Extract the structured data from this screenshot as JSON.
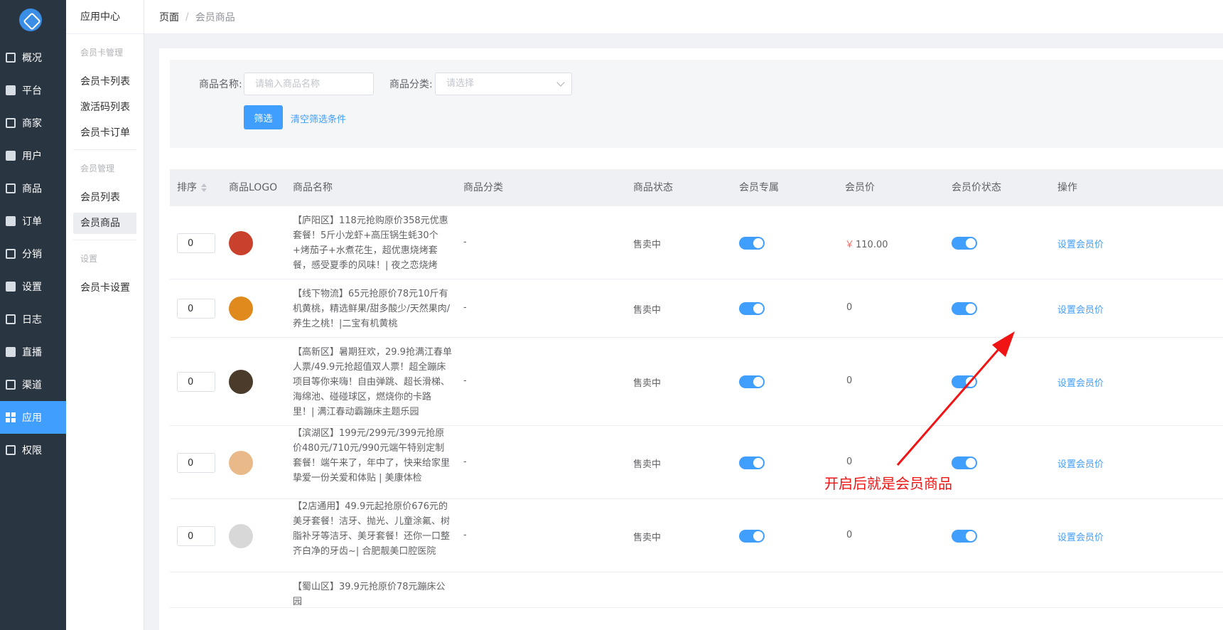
{
  "nav_rail": {
    "items": [
      {
        "label": "概况",
        "icon": "chart-icon"
      },
      {
        "label": "平台",
        "icon": "monitor-icon"
      },
      {
        "label": "商家",
        "icon": "store-icon"
      },
      {
        "label": "用户",
        "icon": "user-icon"
      },
      {
        "label": "商品",
        "icon": "product-icon"
      },
      {
        "label": "订单",
        "icon": "order-icon"
      },
      {
        "label": "分销",
        "icon": "distribution-icon"
      },
      {
        "label": "设置",
        "icon": "gear-icon"
      },
      {
        "label": "日志",
        "icon": "log-icon"
      },
      {
        "label": "直播",
        "icon": "live-icon"
      },
      {
        "label": "渠道",
        "icon": "channel-icon"
      },
      {
        "label": "应用",
        "icon": "apps-icon"
      },
      {
        "label": "权限",
        "icon": "lock-icon"
      }
    ],
    "active_index": 11
  },
  "sub_nav": {
    "title": "应用中心",
    "group_membercard": "会员卡管理",
    "item_card_list": "会员卡列表",
    "item_activation_codes": "激活码列表",
    "item_card_orders": "会员卡订单",
    "group_member": "会员管理",
    "item_member_list": "会员列表",
    "item_member_goods": "会员商品",
    "group_settings": "设置",
    "item_card_settings": "会员卡设置"
  },
  "breadcrumb": {
    "root": "页面",
    "separator": "/",
    "current": "会员商品"
  },
  "filter": {
    "name_label": "商品名称:",
    "name_placeholder": "请输入商品名称",
    "category_label": "商品分类:",
    "category_placeholder": "请选择",
    "submit_label": "筛选",
    "clear_label": "清空筛选条件"
  },
  "table": {
    "headers": {
      "sort": "排序",
      "logo": "商品LOGO",
      "name": "商品名称",
      "category": "商品分类",
      "status": "商品状态",
      "member_only": "会员专属",
      "member_price": "会员价",
      "member_price_status": "会员价状态",
      "actions": "操作"
    },
    "rows": [
      {
        "sort": "0",
        "name": "【庐阳区】118元抢购原价358元优惠套餐！5斤小龙虾+高压锅生蚝30个+烤茄子+水煮花生，超优惠烧烤套餐，感受夏季的风味！| 夜之恋烧烤",
        "category": "-",
        "status": "售卖中",
        "member_only": true,
        "price_symbol": "￥",
        "price": "110.00",
        "price_status": true,
        "action": "设置会员价",
        "thumb_color": "#c9402c"
      },
      {
        "sort": "0",
        "name": "【线下物流】65元抢原价78元10斤有机黄桃，精选鲜果/甜多酸少/天然果肉/养生之桃！|二宝有机黄桃",
        "category": "-",
        "status": "售卖中",
        "member_only": true,
        "price_symbol": "",
        "price": "0",
        "price_status": true,
        "action": "设置会员价",
        "thumb_color": "#e08a1e"
      },
      {
        "sort": "0",
        "name": "【高新区】暑期狂欢，29.9抢满江春单人票/49.9元抢超值双人票！超全蹦床项目等你来嗨！自由弹跳、超长滑梯、海绵池、碰碰球区，燃烧你的卡路里！| 满江春动霸蹦床主题乐园",
        "category": "-",
        "status": "售卖中",
        "member_only": true,
        "price_symbol": "",
        "price": "0",
        "price_status": true,
        "action": "设置会员价",
        "thumb_color": "#4a3b2a"
      },
      {
        "sort": "0",
        "name": "【滨湖区】199元/299元/399元抢原价480元/710元/990元端午特别定制套餐！端午来了，年中了，快来给家里挚爱一份关爱和体贴 | 美康体检",
        "category": "-",
        "status": "售卖中",
        "member_only": true,
        "price_symbol": "",
        "price": "0",
        "price_status": true,
        "action": "设置会员价",
        "thumb_color": "#e9b98a"
      },
      {
        "sort": "0",
        "name": "【2店通用】49.9元起抢原价676元的美牙套餐！洁牙、抛光、儿童涂氟、树脂补牙等洁牙、美牙套餐！还你一口整齐白净的牙齿~| 合肥靓美口腔医院",
        "category": "-",
        "status": "售卖中",
        "member_only": true,
        "price_symbol": "",
        "price": "0",
        "price_status": true,
        "action": "设置会员价",
        "thumb_color": "#d8d8d8"
      },
      {
        "sort": "",
        "name": "【蜀山区】39.9元抢原价78元蹦床公园",
        "category": "",
        "status": "",
        "member_only": false,
        "price_symbol": "",
        "price": "",
        "price_status": false,
        "action": "",
        "thumb_color": ""
      }
    ]
  },
  "annotation": {
    "text": "开启后就是会员商品",
    "color": "#f01414"
  },
  "colors": {
    "primary": "#409eff",
    "sidebar_bg": "#2a3542",
    "price_symbol": "#f56c6c"
  }
}
